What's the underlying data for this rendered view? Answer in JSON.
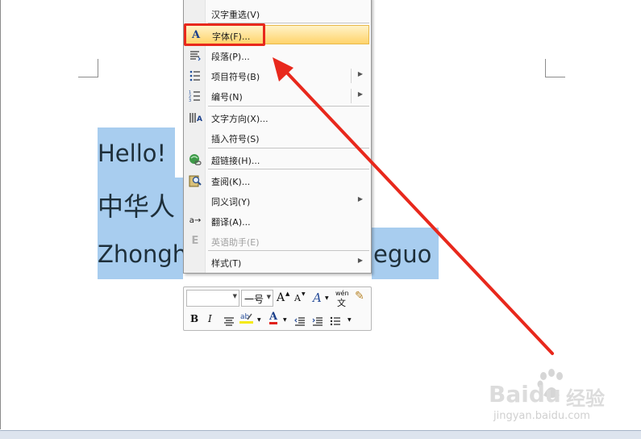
{
  "document": {
    "line1": "Hello!",
    "line2": "中华人",
    "line3_left": "Zhongh",
    "line3_right": "eguo"
  },
  "context_menu": {
    "items": [
      {
        "label": "汉字重选(V)",
        "icon": "none"
      },
      {
        "label": "字体(F)...",
        "icon": "font-icon",
        "highlighted": true
      },
      {
        "label": "段落(P)...",
        "icon": "paragraph-icon"
      },
      {
        "label": "项目符号(B)",
        "icon": "bullets-icon",
        "submenu": true
      },
      {
        "label": "编号(N)",
        "icon": "numbering-icon",
        "submenu": true
      },
      {
        "label": "文字方向(X)...",
        "icon": "text-direction-icon"
      },
      {
        "label": "插入符号(S)",
        "icon": "none"
      },
      {
        "label": "超链接(H)...",
        "icon": "hyperlink-icon"
      },
      {
        "label": "查阅(K)...",
        "icon": "lookup-icon"
      },
      {
        "label": "同义词(Y)",
        "icon": "none",
        "submenu": true
      },
      {
        "label": "翻译(A)...",
        "icon": "translate-icon"
      },
      {
        "label": "英语助手(E)",
        "icon": "english-assistant-icon",
        "disabled": true
      },
      {
        "label": "样式(T)",
        "icon": "none",
        "submenu": true
      }
    ]
  },
  "mini_toolbar": {
    "font_name": "",
    "font_size": "一号",
    "grow_font": "A",
    "shrink_font": "A",
    "styles": "A",
    "phonetic_top": "wén",
    "phonetic_bottom": "文",
    "bold": "B",
    "italic": "I",
    "font_color": "A"
  },
  "watermark": {
    "brand": "Baidu",
    "brand_cn": "经验",
    "url": "jingyan.baidu.com"
  },
  "colors": {
    "selection": "#a8cdef",
    "annotation_red": "#e8281c",
    "menu_hover": "#ffd36b"
  }
}
